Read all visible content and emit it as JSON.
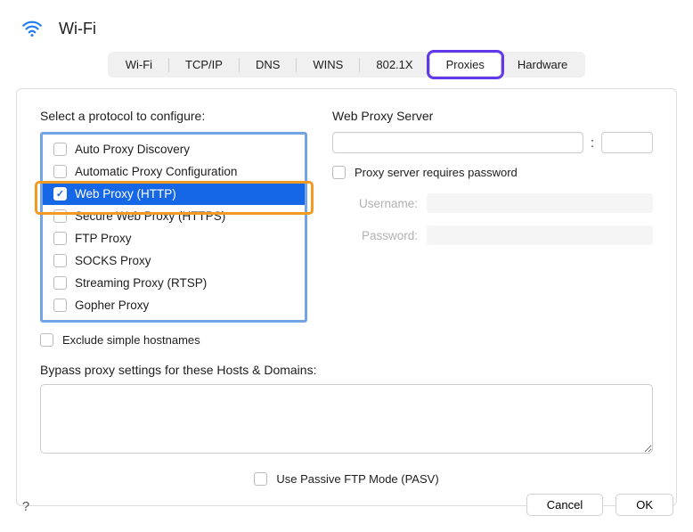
{
  "header": {
    "title": "Wi-Fi"
  },
  "tabs": {
    "items": [
      "Wi-Fi",
      "TCP/IP",
      "DNS",
      "WINS",
      "802.1X",
      "Proxies",
      "Hardware"
    ],
    "active_index": 5
  },
  "left": {
    "label": "Select a protocol to configure:",
    "protocols": [
      {
        "label": "Auto Proxy Discovery",
        "checked": false,
        "selected": false
      },
      {
        "label": "Automatic Proxy Configuration",
        "checked": false,
        "selected": false
      },
      {
        "label": "Web Proxy (HTTP)",
        "checked": true,
        "selected": true
      },
      {
        "label": "Secure Web Proxy (HTTPS)",
        "checked": false,
        "selected": false
      },
      {
        "label": "FTP Proxy",
        "checked": false,
        "selected": false
      },
      {
        "label": "SOCKS Proxy",
        "checked": false,
        "selected": false
      },
      {
        "label": "Streaming Proxy (RTSP)",
        "checked": false,
        "selected": false
      },
      {
        "label": "Gopher Proxy",
        "checked": false,
        "selected": false
      }
    ],
    "exclude_label": "Exclude simple hostnames"
  },
  "right": {
    "server_label": "Web Proxy Server",
    "server_host": "",
    "server_port": "",
    "requires_pw_label": "Proxy server requires password",
    "username_label": "Username:",
    "password_label": "Password:",
    "username_value": "",
    "password_value": ""
  },
  "bypass_label": "Bypass proxy settings for these Hosts & Domains:",
  "bypass_value": "",
  "pasv_label": "Use Passive FTP Mode (PASV)",
  "footer": {
    "cancel": "Cancel",
    "ok": "OK",
    "help": "?"
  }
}
